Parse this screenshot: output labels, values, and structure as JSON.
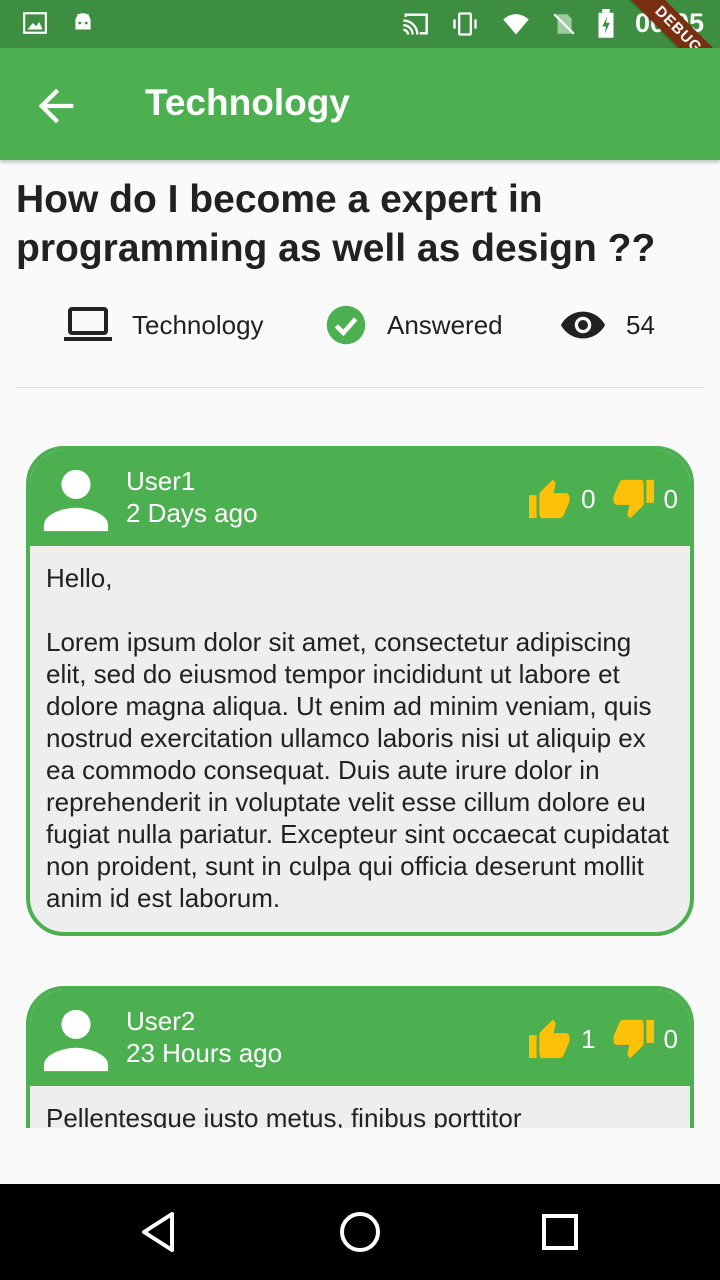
{
  "status_bar": {
    "time": "00:05",
    "debug_label": "DEBUG",
    "icons": [
      "image-icon",
      "android-icon",
      "cast-icon",
      "vibrate-icon",
      "wifi-icon",
      "no-sim-icon",
      "battery-charging-icon"
    ]
  },
  "app_bar": {
    "title": "Technology",
    "back_icon": "arrow-back-icon"
  },
  "question": {
    "title": "How do I become a expert in programming as well as design ??",
    "category": "Technology",
    "status": "Answered",
    "views": "54"
  },
  "answers": [
    {
      "user": "User1",
      "time": "2 Days ago",
      "likes": "0",
      "dislikes": "0",
      "body": "Hello,\n\nLorem ipsum dolor sit amet, consectetur adipiscing elit, sed do eiusmod tempor incididunt ut labore et dolore magna aliqua. Ut enim ad minim veniam, quis nostrud exercitation ullamco laboris nisi ut aliquip ex ea commodo consequat. Duis aute irure dolor in reprehenderit in voluptate velit esse cillum dolore eu fugiat nulla pariatur. Excepteur sint occaecat cupidatat non proident, sunt in culpa qui officia deserunt mollit anim id est laborum."
    },
    {
      "user": "User2",
      "time": "23 Hours ago",
      "likes": "1",
      "dislikes": "0",
      "body": "Pellentesque iusto metus, finibus porttitor"
    }
  ],
  "colors": {
    "primary": "#4caf50",
    "primary_dark": "#3e8e41",
    "vote_icon": "#ffc107",
    "card_bg": "#eeeeee"
  }
}
